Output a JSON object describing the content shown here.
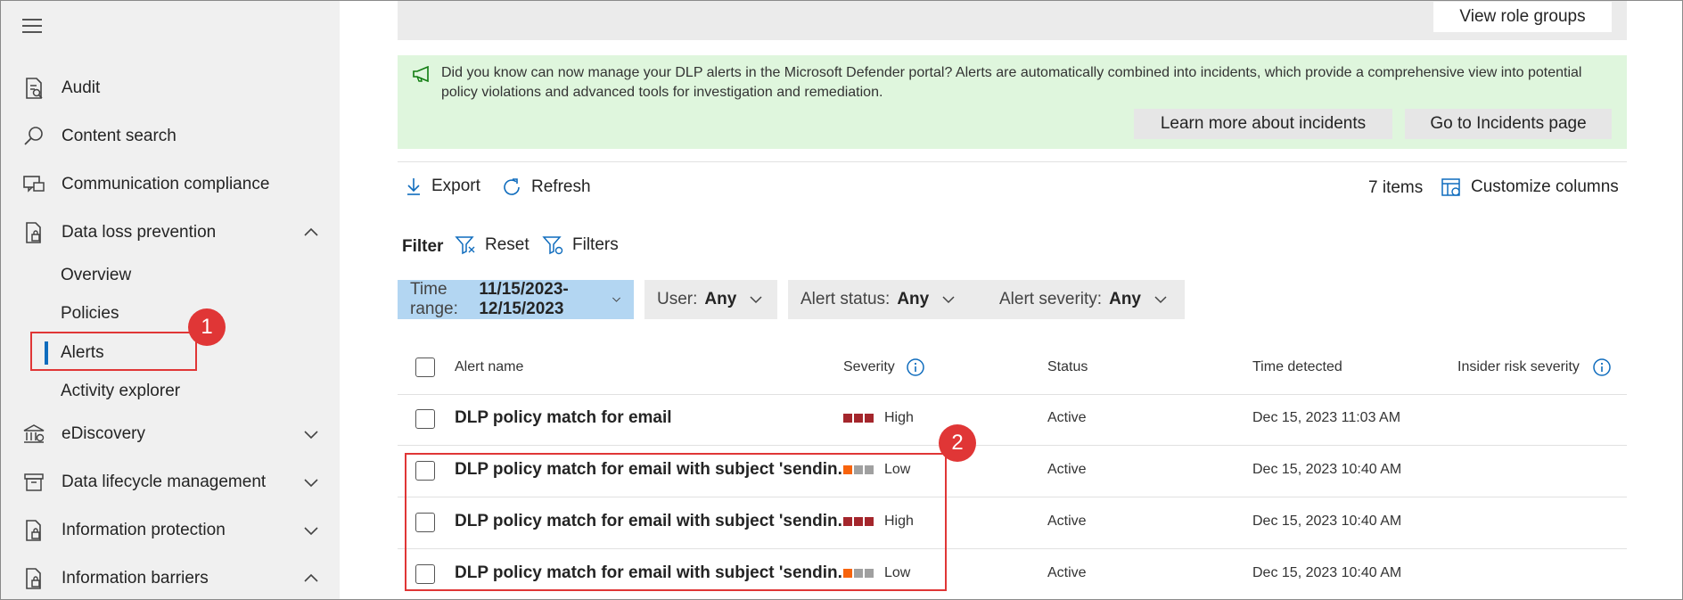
{
  "colors": {
    "accent": "#0f6cbd",
    "annotation": "#e03636",
    "high": "#a4262c",
    "low_active": "#f7630c",
    "low_inactive": "#a0a0a0",
    "banner_bg": "#dff6dd",
    "selected_filter": "#b3d6f2"
  },
  "sidebar": {
    "items": [
      {
        "label": "Audit",
        "icon": "audit-icon"
      },
      {
        "label": "Content search",
        "icon": "search-icon"
      },
      {
        "label": "Communication compliance",
        "icon": "chat-icon"
      },
      {
        "label": "Data loss prevention",
        "icon": "lock-document-icon"
      },
      {
        "label": "eDiscovery",
        "icon": "bank-icon"
      },
      {
        "label": "Data lifecycle management",
        "icon": "archive-icon"
      },
      {
        "label": "Information protection",
        "icon": "lock-document-icon"
      },
      {
        "label": "Information barriers",
        "icon": "lock-document-icon"
      }
    ],
    "dlp_sub": [
      "Overview",
      "Policies",
      "Alerts",
      "Activity explorer"
    ]
  },
  "annotations": {
    "one": "1",
    "two": "2"
  },
  "header": {
    "view_role_groups": "View role groups"
  },
  "banner": {
    "text": "Did you know can now manage your DLP alerts in the Microsoft Defender portal? Alerts are automatically combined into incidents, which provide a comprehensive view into potential policy violations and advanced tools for investigation and remediation.",
    "learn_more": "Learn more about incidents",
    "go_to": "Go to Incidents page"
  },
  "toolbar": {
    "export": "Export",
    "refresh": "Refresh",
    "items_count": "7 items",
    "customize": "Customize columns"
  },
  "filter": {
    "label": "Filter",
    "reset": "Reset",
    "filters": "Filters",
    "time_range_label": "Time range:",
    "time_range_value": "11/15/2023-12/15/2023",
    "user_label": "User:",
    "user_value": "Any",
    "status_label": "Alert status:",
    "status_value": "Any",
    "severity_label": "Alert severity:",
    "severity_value": "Any"
  },
  "table": {
    "columns": [
      "Alert name",
      "Severity",
      "Status",
      "Time detected",
      "Insider risk severity"
    ],
    "rows": [
      {
        "name": "DLP policy match for email",
        "severity": "High",
        "level": 3,
        "status": "Active",
        "time": "Dec 15, 2023 11:03 AM"
      },
      {
        "name": "DLP policy match for email with subject 'sendin...",
        "severity": "Low",
        "level": 1,
        "status": "Active",
        "time": "Dec 15, 2023 10:40 AM"
      },
      {
        "name": "DLP policy match for email with subject 'sendin...",
        "severity": "High",
        "level": 3,
        "status": "Active",
        "time": "Dec 15, 2023 10:40 AM"
      },
      {
        "name": "DLP policy match for email with subject 'sendin...",
        "severity": "Low",
        "level": 1,
        "status": "Active",
        "time": "Dec 15, 2023 10:40 AM"
      }
    ]
  }
}
